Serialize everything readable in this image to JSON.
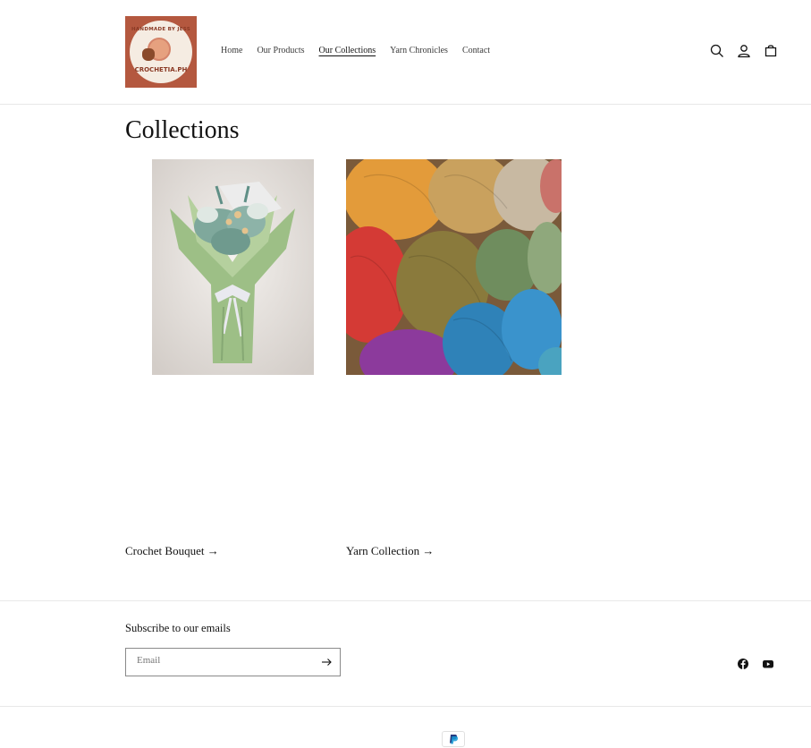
{
  "brand": {
    "logo_top_text": "HANDMADE BY JESS",
    "logo_bottom_text": "CROCHETIA.PH",
    "logo_bg": "#b4583f"
  },
  "nav": {
    "items": [
      {
        "label": "Home",
        "active": false
      },
      {
        "label": "Our Products",
        "active": false
      },
      {
        "label": "Our Collections",
        "active": true
      },
      {
        "label": "Yarn Chronicles",
        "active": false
      },
      {
        "label": "Contact",
        "active": false
      }
    ]
  },
  "header_icons": [
    "search-icon",
    "account-icon",
    "cart-icon"
  ],
  "main": {
    "title": "Collections",
    "collections": [
      {
        "label": "Crochet Bouquet",
        "arrow": "→",
        "image": "crochet-bouquet-photo"
      },
      {
        "label": "Yarn Collection",
        "arrow": "→",
        "image": "yarn-balls-photo"
      }
    ]
  },
  "footer": {
    "subscribe_heading": "Subscribe to our emails",
    "email_placeholder": "Email",
    "social": [
      "facebook-icon",
      "youtube-icon"
    ],
    "payment": "paypal-icon"
  }
}
